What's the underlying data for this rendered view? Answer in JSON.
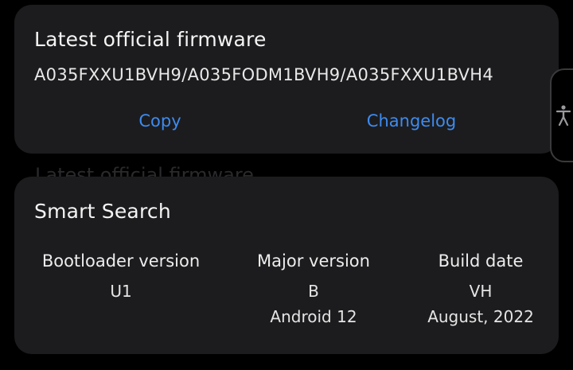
{
  "firmware_card": {
    "title": "Latest official firmware",
    "firmware": "A035FXXU1BVH9/A035FODM1BVH9/A035FXXU1BVH4",
    "copy_label": "Copy",
    "changelog_label": "Changelog"
  },
  "ghost_title": "Latest official firmware",
  "smart_search": {
    "title": "Smart Search",
    "columns": [
      {
        "label": "Bootloader version",
        "value": "U1",
        "sub": ""
      },
      {
        "label": "Major version",
        "value": "B",
        "sub": "Android 12"
      },
      {
        "label": "Build date",
        "value": "VH",
        "sub": "August, 2022"
      }
    ]
  },
  "side_handle": {
    "icon": "accessibility-icon"
  },
  "colors": {
    "background": "#000000",
    "card": "#1c1c1e",
    "link": "#3d8bf0",
    "text": "#f2f2f2"
  }
}
